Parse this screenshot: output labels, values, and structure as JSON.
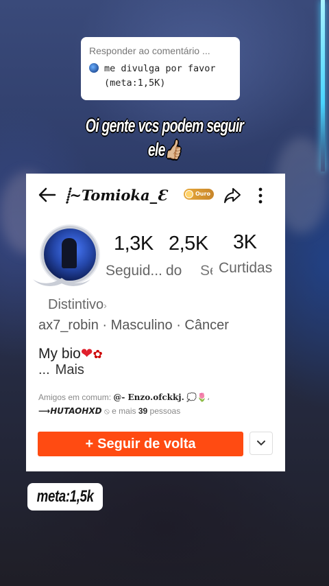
{
  "reply_bubble": {
    "title": "Responder ao comentário ...",
    "comment_line1": "me divulga por favor",
    "comment_line2": "(meta:1,5K)"
  },
  "caption": {
    "line1": "Oi gente vcs podem seguir",
    "line2": "ele👍🏼"
  },
  "profile": {
    "username": "⸽~Tomioka_Ɛ",
    "badge": "Ouro",
    "stats": [
      {
        "value": "1,3K",
        "label": "Seguid..."
      },
      {
        "value": "2,5K",
        "label": "do"
      },
      {
        "value": "3K",
        "label": "Curtidas"
      }
    ],
    "stat_cut_label": "Se",
    "distintivo": "Distintivo",
    "meta": "ax7_robin · Masculino · Câncer",
    "bio": "My bio",
    "bio_more_dots": "...",
    "bio_more": "Mais",
    "friends_prefix": "Amigos em comum:",
    "friend1": "@- Enzo.ofckkj.",
    "friend2": "HUTAOHXD",
    "friends_suffix_a": "e mais",
    "friends_count": "39",
    "friends_suffix_b": "pessoas",
    "follow_button": "Seguir de volta"
  },
  "meta_tag": "meta:1,5k",
  "colors": {
    "accent": "#ff4b12",
    "badge": "#d9962f"
  },
  "icons": [
    "back-arrow-icon",
    "share-icon",
    "more-vertical-icon",
    "chevron-down-icon",
    "plus-icon"
  ]
}
